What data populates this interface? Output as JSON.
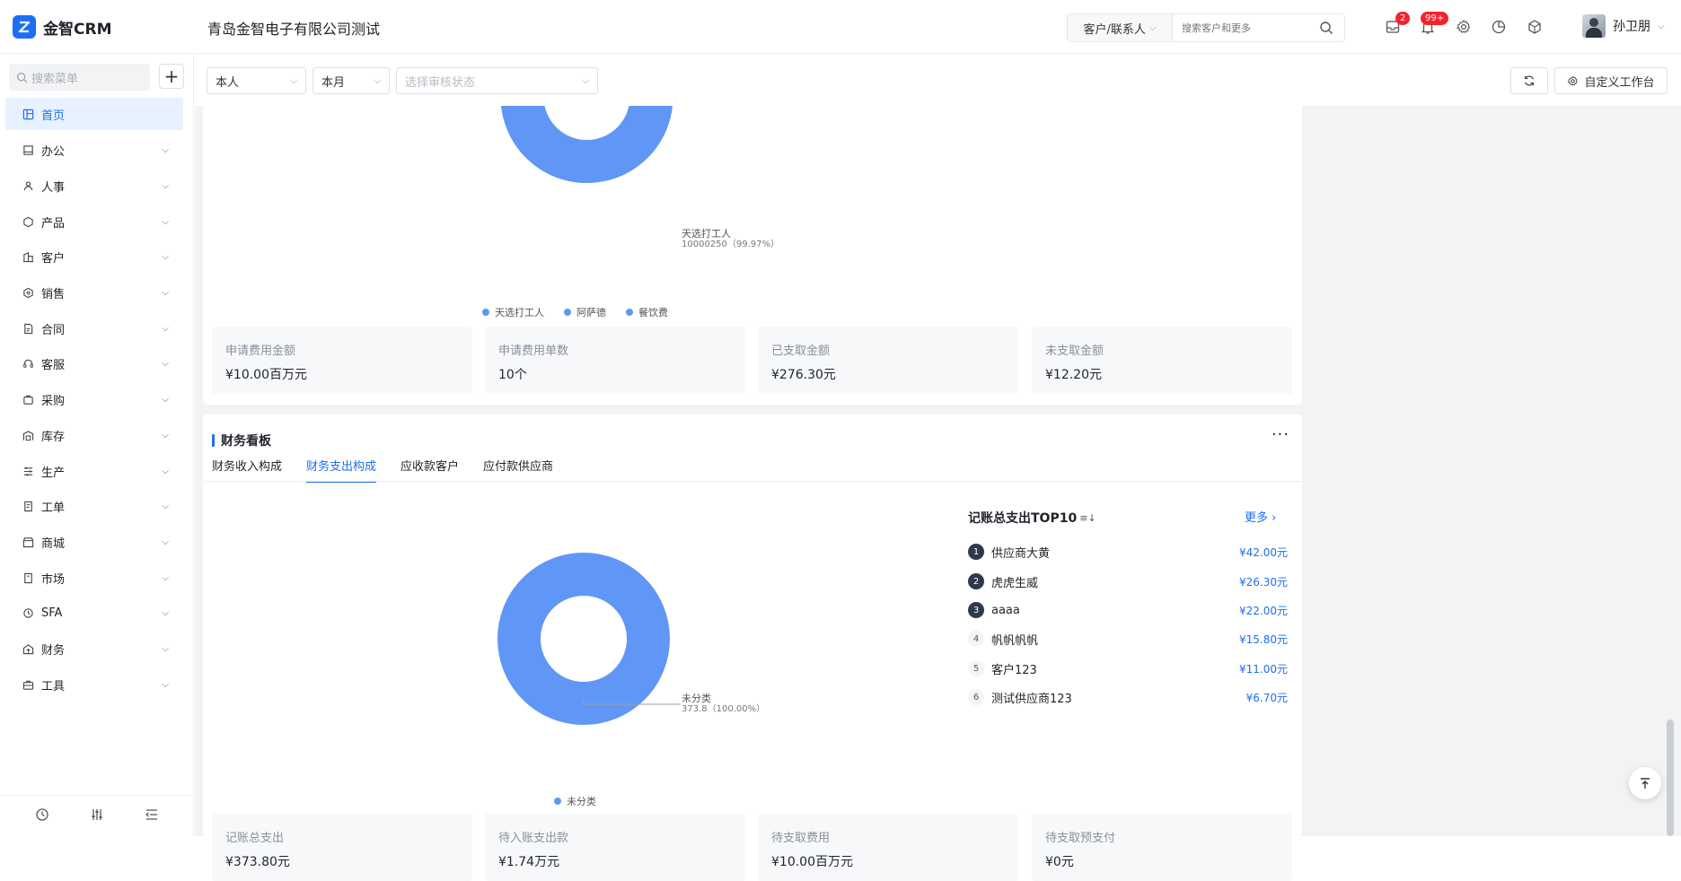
{
  "app": {
    "logo_text": "金智CRM",
    "company": "青岛金智电子有限公司测试"
  },
  "header": {
    "search_type": "客户/联系人",
    "search_placeholder": "搜索客户和更多",
    "badge_messages": "2",
    "badge_notifications": "99+",
    "user_name": "孙卫朋"
  },
  "sidebar": {
    "search_placeholder": "搜索菜单",
    "items": [
      {
        "label": "首页",
        "icon": "dashboard-icon"
      },
      {
        "label": "办公",
        "icon": "office-icon"
      },
      {
        "label": "人事",
        "icon": "people-icon"
      },
      {
        "label": "产品",
        "icon": "box-icon"
      },
      {
        "label": "客户",
        "icon": "building-icon"
      },
      {
        "label": "销售",
        "icon": "sales-icon"
      },
      {
        "label": "合同",
        "icon": "contract-icon"
      },
      {
        "label": "客服",
        "icon": "headset-icon"
      },
      {
        "label": "采购",
        "icon": "cart-icon"
      },
      {
        "label": "库存",
        "icon": "warehouse-icon"
      },
      {
        "label": "生产",
        "icon": "factory-icon"
      },
      {
        "label": "工单",
        "icon": "ticket-icon"
      },
      {
        "label": "商城",
        "icon": "store-icon"
      },
      {
        "label": "市场",
        "icon": "market-icon"
      },
      {
        "label": "SFA",
        "icon": "sfa-icon"
      },
      {
        "label": "财务",
        "icon": "finance-icon"
      },
      {
        "label": "工具",
        "icon": "toolbox-icon"
      }
    ]
  },
  "filters": {
    "owner": "本人",
    "period": "本月",
    "status_placeholder": "选择审核状态",
    "customize_label": "自定义工作台"
  },
  "expense_card": {
    "pie_label_name": "天选打工人",
    "pie_label_value": "10000250（99.97%）",
    "legend": [
      "天选打工人",
      "阿萨德",
      "餐饮费"
    ],
    "stats": [
      {
        "label": "申请费用金额",
        "value": "¥10.00百万元"
      },
      {
        "label": "申请费用单数",
        "value": "10个"
      },
      {
        "label": "已支取金额",
        "value": "¥276.30元"
      },
      {
        "label": "未支取金额",
        "value": "¥12.20元"
      }
    ]
  },
  "finance_card": {
    "title": "财务看板",
    "tabs": [
      "财务收入构成",
      "财务支出构成",
      "应收款客户",
      "应付款供应商"
    ],
    "active_tab": 1,
    "pie_label_name": "未分类",
    "pie_label_value": "373.8（100.00%）",
    "legend": [
      "未分类"
    ],
    "top10_title": "记账总支出TOP10",
    "more_label": "更多",
    "ranking": [
      {
        "rank": "1",
        "name": "供应商大黄",
        "amount": "¥42.00元"
      },
      {
        "rank": "2",
        "name": "虎虎生威",
        "amount": "¥26.30元"
      },
      {
        "rank": "3",
        "name": "aaaa",
        "amount": "¥22.00元"
      },
      {
        "rank": "4",
        "name": "帆帆帆帆",
        "amount": "¥15.80元"
      },
      {
        "rank": "5",
        "name": "客户123",
        "amount": "¥11.00元"
      },
      {
        "rank": "6",
        "name": "测试供应商123",
        "amount": "¥6.70元"
      }
    ],
    "stats": [
      {
        "label": "记账总支出",
        "value": "¥373.80元"
      },
      {
        "label": "待入账支出款",
        "value": "¥1.74万元"
      },
      {
        "label": "待支取费用",
        "value": "¥10.00百万元"
      },
      {
        "label": "待支取预支付",
        "value": "¥0元"
      }
    ]
  },
  "colors": {
    "accent": "#1d6ff2",
    "pie": "#6097f6",
    "badge": "#f5222d"
  }
}
